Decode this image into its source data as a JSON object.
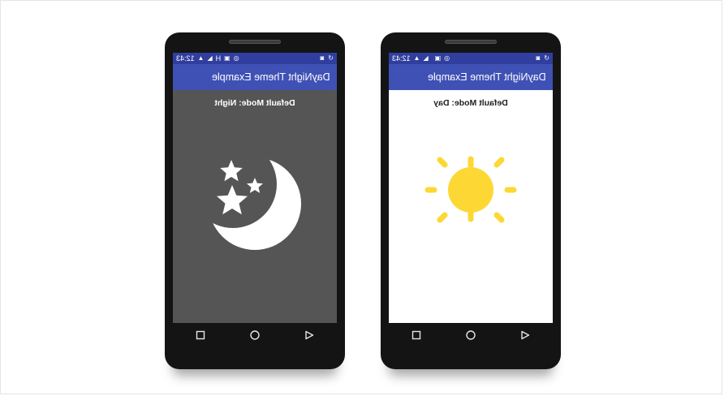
{
  "phones": [
    {
      "id": "night",
      "status_bar": {
        "time": "12:43",
        "network": "H"
      },
      "app_title": "DayNight Theme Example",
      "mode_text": "Default Mode: Night",
      "illustration": "moon-and-stars-icon",
      "colors": {
        "status": "#303f9f",
        "app_bar": "#3f51b5",
        "content_bg": "#555555",
        "art": "#ffffff"
      }
    },
    {
      "id": "day",
      "status_bar": {
        "time": "12:43",
        "network": ""
      },
      "app_title": "DayNight Theme Example",
      "mode_text": "Default Mode: Day",
      "illustration": "sun-icon",
      "colors": {
        "status": "#303f9f",
        "app_bar": "#3f51b5",
        "content_bg": "#ffffff",
        "art": "#fdd835"
      }
    }
  ],
  "nav_buttons": [
    "recent-apps",
    "home",
    "back"
  ]
}
